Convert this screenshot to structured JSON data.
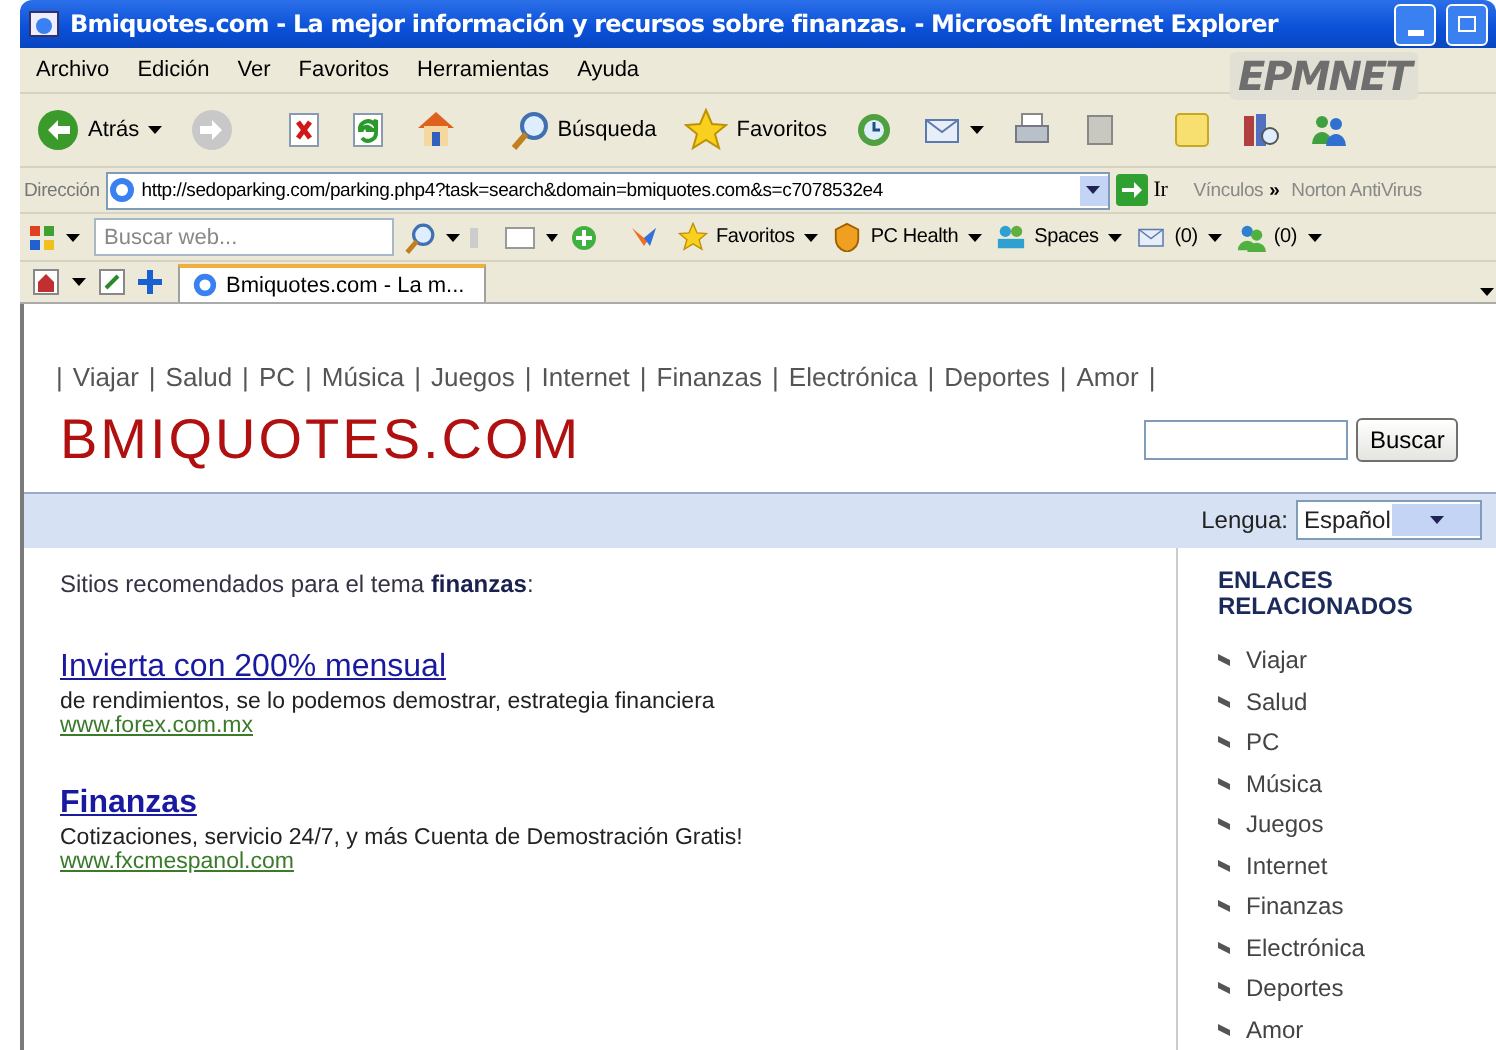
{
  "window": {
    "title": "Bmiquotes.com - La mejor información y recursos sobre finanzas. - Microsoft Internet Explorer"
  },
  "menu": [
    "Archivo",
    "Edición",
    "Ver",
    "Favoritos",
    "Herramientas",
    "Ayuda"
  ],
  "logo": "EPMNET",
  "toolbar": [
    {
      "kind": "back",
      "label": "Atrás"
    },
    {
      "kind": "forward"
    },
    {
      "kind": "stop"
    },
    {
      "kind": "refresh"
    },
    {
      "kind": "home"
    },
    {
      "kind": "search",
      "label": "Búsqueda"
    },
    {
      "kind": "favorites",
      "label": "Favoritos"
    },
    {
      "kind": "history"
    },
    {
      "kind": "mail"
    },
    {
      "kind": "print"
    },
    {
      "kind": "edit"
    },
    {
      "kind": "note"
    },
    {
      "kind": "research"
    },
    {
      "kind": "messenger"
    }
  ],
  "address": {
    "label": "Dirección",
    "url": "http://sedoparking.com/parking.php4?task=search&domain=bmiquotes.com&s=c7078532e4",
    "go": "Ir",
    "links": "Vínculos",
    "chevron": "»",
    "extra": "Norton AntiVirus"
  },
  "live_toolbar": {
    "search_placeholder": "Buscar web...",
    "items": [
      {
        "kind": "favorites",
        "label": "Favoritos"
      },
      {
        "kind": "health",
        "label": "PC Health"
      },
      {
        "kind": "spaces",
        "label": "Spaces"
      },
      {
        "kind": "mail",
        "label": "(0)"
      },
      {
        "kind": "contacts",
        "label": "(0)"
      }
    ]
  },
  "tabs": [
    {
      "label": "Bmiquotes.com - La m...",
      "selected": true
    }
  ],
  "page": {
    "separator": "|",
    "nav": [
      "Viajar",
      "Salud",
      "PC",
      "Música",
      "Juegos",
      "Internet",
      "Finanzas",
      "Electrónica",
      "Deportes",
      "Amor"
    ],
    "site_title": "BMIQUOTES.COM",
    "search_button": "Buscar",
    "language": {
      "label": "Lengua:",
      "value": "Español"
    },
    "intro": "Sitios recomendados para el tema **finanzas**:",
    "results": [
      {
        "title": "Invierta con 200% mensual",
        "description": "de rendimientos, se lo podemos demostrar, estrategia financiera",
        "url": "www.forex.com.mx"
      },
      {
        "title": "Finanzas",
        "description": "Cotizaciones, servicio 24/7, y más Cuenta de Demostración Gratis!",
        "url": "www.fxcmespanol.com"
      }
    ],
    "sidebar": {
      "title": "ENLACES RELACIONADOS",
      "links": [
        "Viajar",
        "Salud",
        "PC",
        "Música",
        "Juegos",
        "Internet",
        "Finanzas",
        "Electrónica",
        "Deportes",
        "Amor"
      ]
    }
  }
}
